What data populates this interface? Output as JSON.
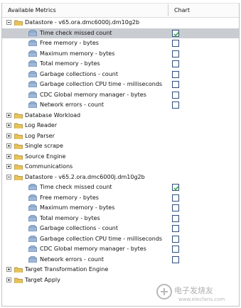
{
  "header": {
    "metrics_label": "Available Metrics",
    "chart_label": "Chart"
  },
  "tree": [
    {
      "level": 0,
      "expanded": true,
      "label": "Datastore - v65.ora.dmc6000j.dm10g2b"
    },
    {
      "level": 1,
      "label": "Time check missed count",
      "checked": true,
      "selected": true
    },
    {
      "level": 1,
      "label": "Free memory - bytes",
      "checked": false
    },
    {
      "level": 1,
      "label": "Maximum memory - bytes",
      "checked": false
    },
    {
      "level": 1,
      "label": "Total memory - bytes",
      "checked": false
    },
    {
      "level": 1,
      "label": "Garbage collections - count",
      "checked": false
    },
    {
      "level": 1,
      "label": "Garbage collection CPU time - milliseconds",
      "checked": false
    },
    {
      "level": 1,
      "label": "CDC Global memory manager - bytes",
      "checked": false
    },
    {
      "level": 1,
      "label": "Network errors - count",
      "checked": false
    },
    {
      "level": 0,
      "expanded": false,
      "label": "Database Workload"
    },
    {
      "level": 0,
      "expanded": false,
      "label": "Log Reader"
    },
    {
      "level": 0,
      "expanded": false,
      "label": "Log Parser"
    },
    {
      "level": 0,
      "expanded": false,
      "label": "Single scrape"
    },
    {
      "level": 0,
      "expanded": false,
      "label": "Source Engine"
    },
    {
      "level": 0,
      "expanded": false,
      "label": "Communications"
    },
    {
      "level": 0,
      "expanded": true,
      "label": "Datastore - v65.2.ora.dmc6000j.dm10g2b"
    },
    {
      "level": 1,
      "label": "Time check missed count",
      "checked": true
    },
    {
      "level": 1,
      "label": "Free memory - bytes",
      "checked": false
    },
    {
      "level": 1,
      "label": "Maximum memory - bytes",
      "checked": false
    },
    {
      "level": 1,
      "label": "Total memory - bytes",
      "checked": false
    },
    {
      "level": 1,
      "label": "Garbage collections - count",
      "checked": false
    },
    {
      "level": 1,
      "label": "Garbage collection CPU time - milliseconds",
      "checked": false
    },
    {
      "level": 1,
      "label": "CDC Global memory manager - bytes",
      "checked": false
    },
    {
      "level": 1,
      "label": "Network errors - count",
      "checked": false
    },
    {
      "level": 0,
      "expanded": false,
      "label": "Target Transformation Engine"
    },
    {
      "level": 0,
      "expanded": false,
      "label": "Target Apply"
    }
  ],
  "watermark": {
    "brand": "电子发烧友",
    "url": "www.elecfans.com"
  },
  "colors": {
    "checkmark": "#3aa83a",
    "checkbox_border": "#2d4e7e",
    "folder": "#e8c35a",
    "metric_icon": "#9fb8d8",
    "selection": "#c9cdd2"
  }
}
